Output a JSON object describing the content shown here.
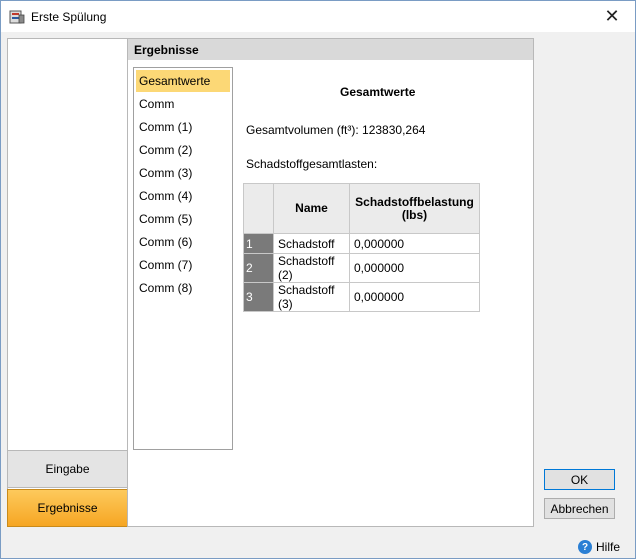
{
  "window": {
    "title": "Erste Spülung",
    "close_label": "✕"
  },
  "nav": {
    "eingabe_label": "Eingabe",
    "ergebnisse_label": "Ergebnisse"
  },
  "main": {
    "header": "Ergebnisse",
    "list_items": [
      "Gesamtwerte",
      "Comm",
      "Comm (1)",
      "Comm (2)",
      "Comm (3)",
      "Comm (4)",
      "Comm (5)",
      "Comm (6)",
      "Comm (7)",
      "Comm (8)"
    ],
    "selected_index": 0,
    "section_title": "Gesamtwerte",
    "volume_text": "Gesamtvolumen (ft³): 123830,264",
    "loads_label": "Schadstoffgesamtlasten:",
    "table": {
      "headers": [
        "",
        "Name",
        "Schadstoffbelastung (lbs)"
      ],
      "rows": [
        [
          "1",
          "Schadstoff",
          "0,000000"
        ],
        [
          "2",
          "Schadstoff (2)",
          "0,000000"
        ],
        [
          "3",
          "Schadstoff (3)",
          "0,000000"
        ]
      ]
    }
  },
  "buttons": {
    "ok_label": "OK",
    "cancel_label": "Abbrechen"
  },
  "help": {
    "label": "Hilfe",
    "icon_glyph": "?"
  },
  "colors": {
    "selected": "#fcd876",
    "active_tab": "#f6a623",
    "row_header": "#7a7a7a"
  }
}
